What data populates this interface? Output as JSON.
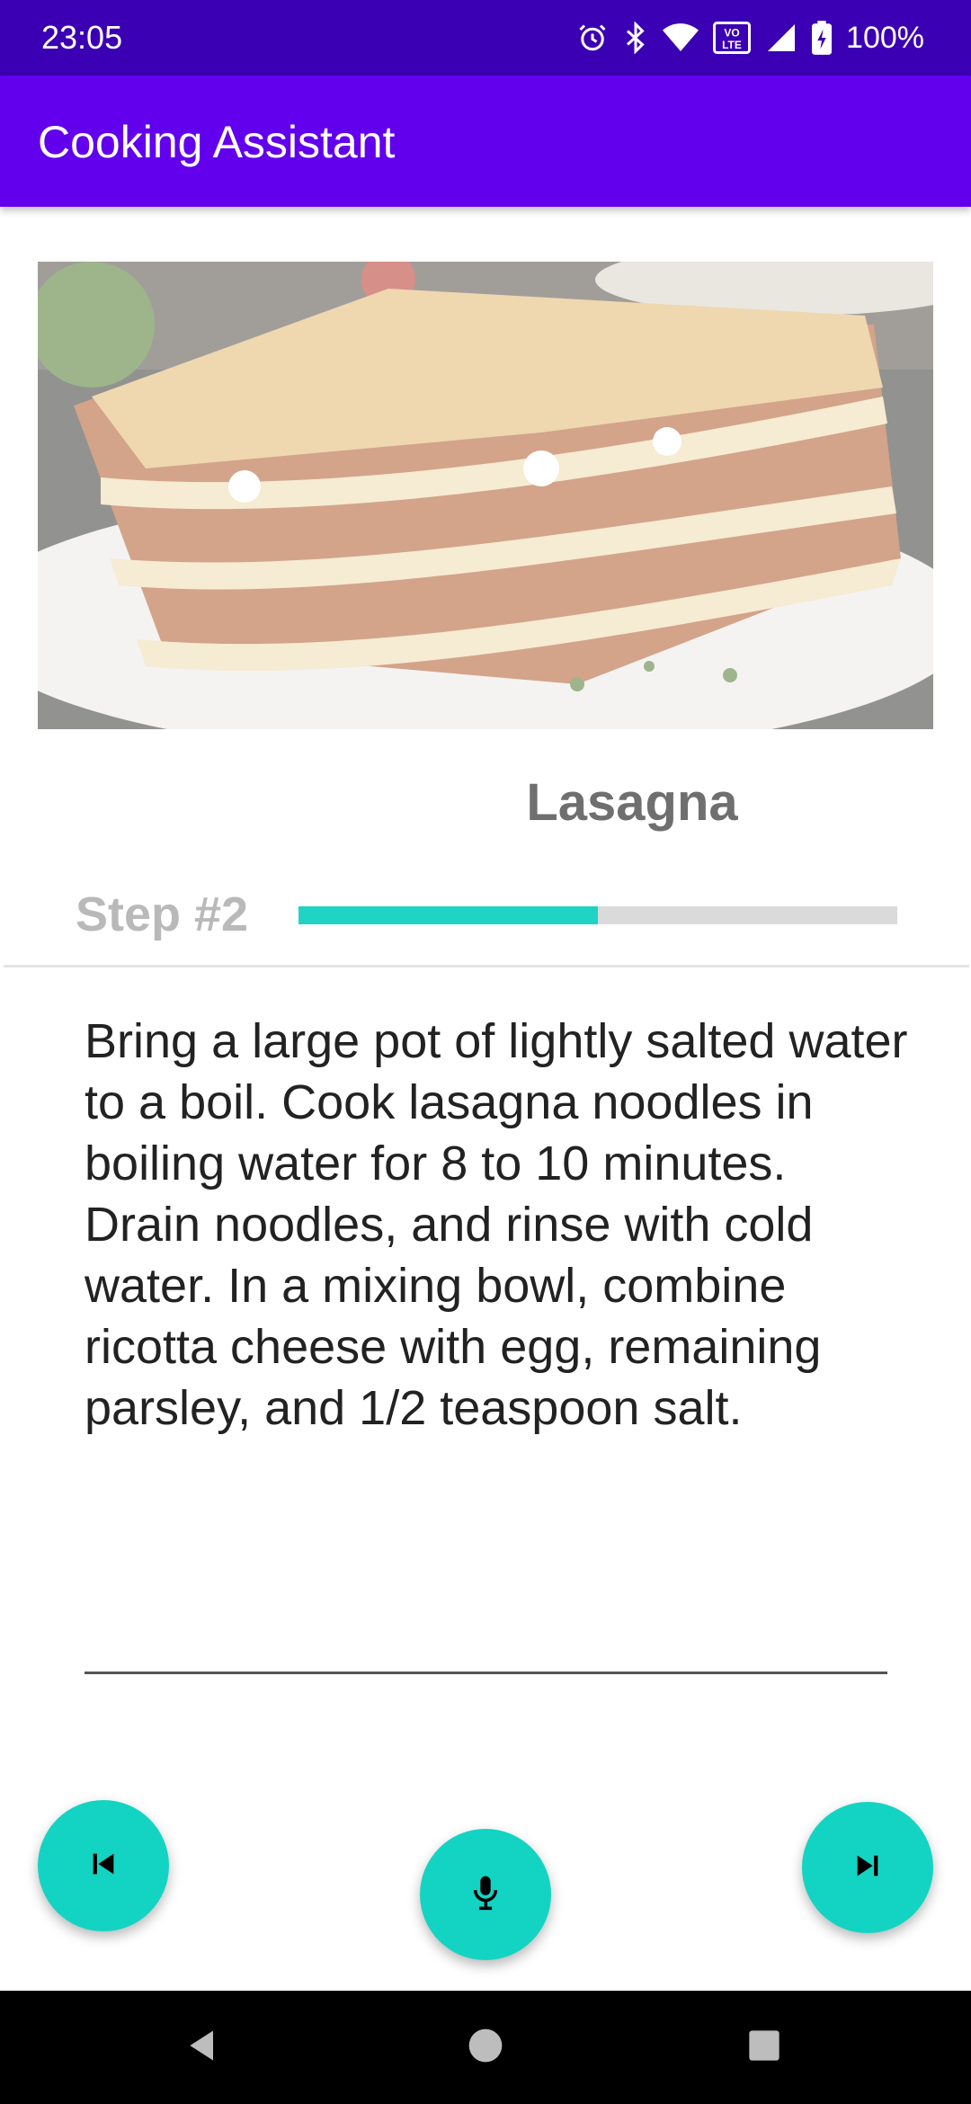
{
  "status_bar": {
    "time": "23:05",
    "battery_percent": "100%",
    "icons": [
      "alarm-icon",
      "bluetooth-icon",
      "wifi-icon",
      "volte-icon",
      "cell-signal-icon",
      "battery-icon"
    ]
  },
  "app_bar": {
    "title": "Cooking Assistant",
    "color": "#6200ee"
  },
  "recipe": {
    "name": "Lasagna",
    "step_label": "Step #2",
    "progress": 0.5,
    "instruction": "Bring a large pot of lightly salted water to a boil. Cook lasagna noodles in boiling water for 8 to 10 minutes. Drain noodles, and rinse with cold water. In a mixing bowl, combine ricotta cheese with egg, remaining parsley, and 1/2 teaspoon salt."
  },
  "controls": {
    "previous": "skip-previous-icon",
    "microphone": "microphone-icon",
    "next": "skip-next-icon",
    "accent": "#13d4c3"
  },
  "nav_bar": {
    "icons": [
      "back-icon",
      "home-icon",
      "recents-icon"
    ]
  }
}
